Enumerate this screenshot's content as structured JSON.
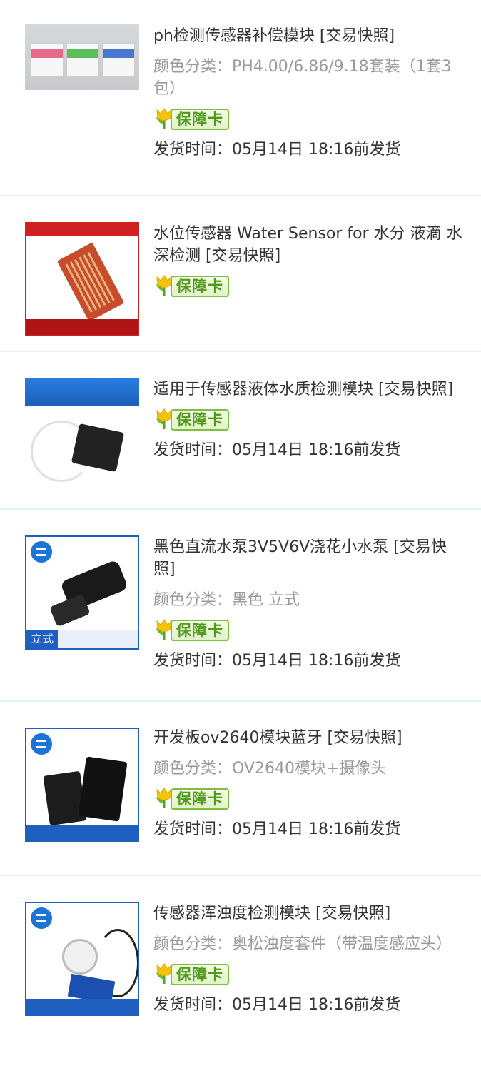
{
  "orders": [
    {
      "title": "ph检测传感器补偿模块 [交易快照]",
      "spec": "颜色分类：PH4.00/6.86/9.18套装（1套3包）",
      "badge": "保障卡",
      "ship": "发货时间：05月14日 18:16前发货"
    },
    {
      "title": "水位传感器 Water Sensor for 水分 液滴 水深检测 [交易快照]",
      "badge": "保障卡"
    },
    {
      "title": "适用于传感器液体水质检测模块 [交易快照]",
      "badge": "保障卡",
      "ship": "发货时间：05月14日 18:16前发货"
    },
    {
      "title": "黑色直流水泵3V5V6V浇花小水泵 [交易快照]",
      "spec": "颜色分类：黑色 立式",
      "badge": "保障卡",
      "ship": "发货时间：05月14日 18:16前发货",
      "thumb_tag": "立式"
    },
    {
      "title": "开发板ov2640模块蓝牙 [交易快照]",
      "spec": "颜色分类：OV2640模块+摄像头",
      "badge": "保障卡",
      "ship": "发货时间：05月14日 18:16前发货"
    },
    {
      "title": "传感器浑浊度检测模块 [交易快照]",
      "spec": "颜色分类：奥松浊度套件（带温度感应头）",
      "badge": "保障卡",
      "ship": "发货时间：05月14日 18:16前发货"
    }
  ],
  "colors": {
    "title": "#333333",
    "spec": "#9a9a9a",
    "divider": "#e6f1f7",
    "badge_green": "#4f9a1a",
    "tulip_yellow": "#f5c400"
  }
}
